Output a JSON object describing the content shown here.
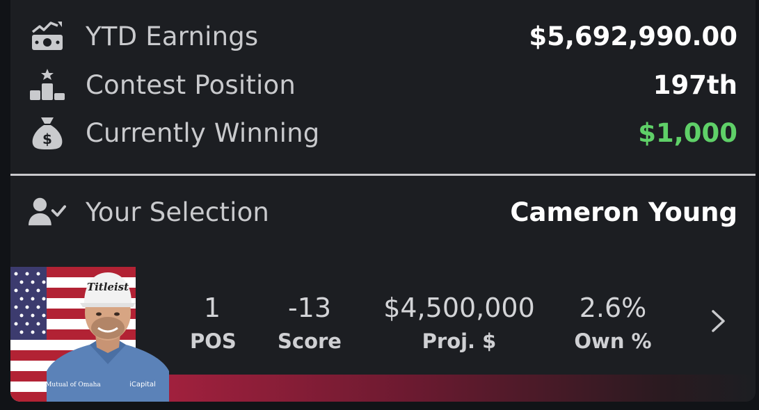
{
  "summary": {
    "earnings": {
      "label": "YTD Earnings",
      "value": "$5,692,990.00",
      "icon": "chart-money-icon"
    },
    "position": {
      "label": "Contest Position",
      "value": "197th",
      "icon": "podium-icon"
    },
    "winning": {
      "label": "Currently Winning",
      "value": "$1,000",
      "icon": "money-bag-icon",
      "color": "#5fd068"
    }
  },
  "selection": {
    "label": "Your Selection",
    "value": "Cameron Young",
    "icon": "user-check-icon"
  },
  "player": {
    "photo_text_cap": "Titleist",
    "photo_text_left": "Mutual of Omaha",
    "photo_text_right": "iCapital",
    "stats": [
      {
        "value": "1",
        "label": "POS"
      },
      {
        "value": "-13",
        "label": "Score"
      },
      {
        "value": "$4,500,000",
        "label": "Proj. $"
      },
      {
        "value": "2.6%",
        "label": "Own %"
      }
    ]
  },
  "colors": {
    "accent_band": "#a8213f",
    "winning_green": "#5fd068"
  }
}
